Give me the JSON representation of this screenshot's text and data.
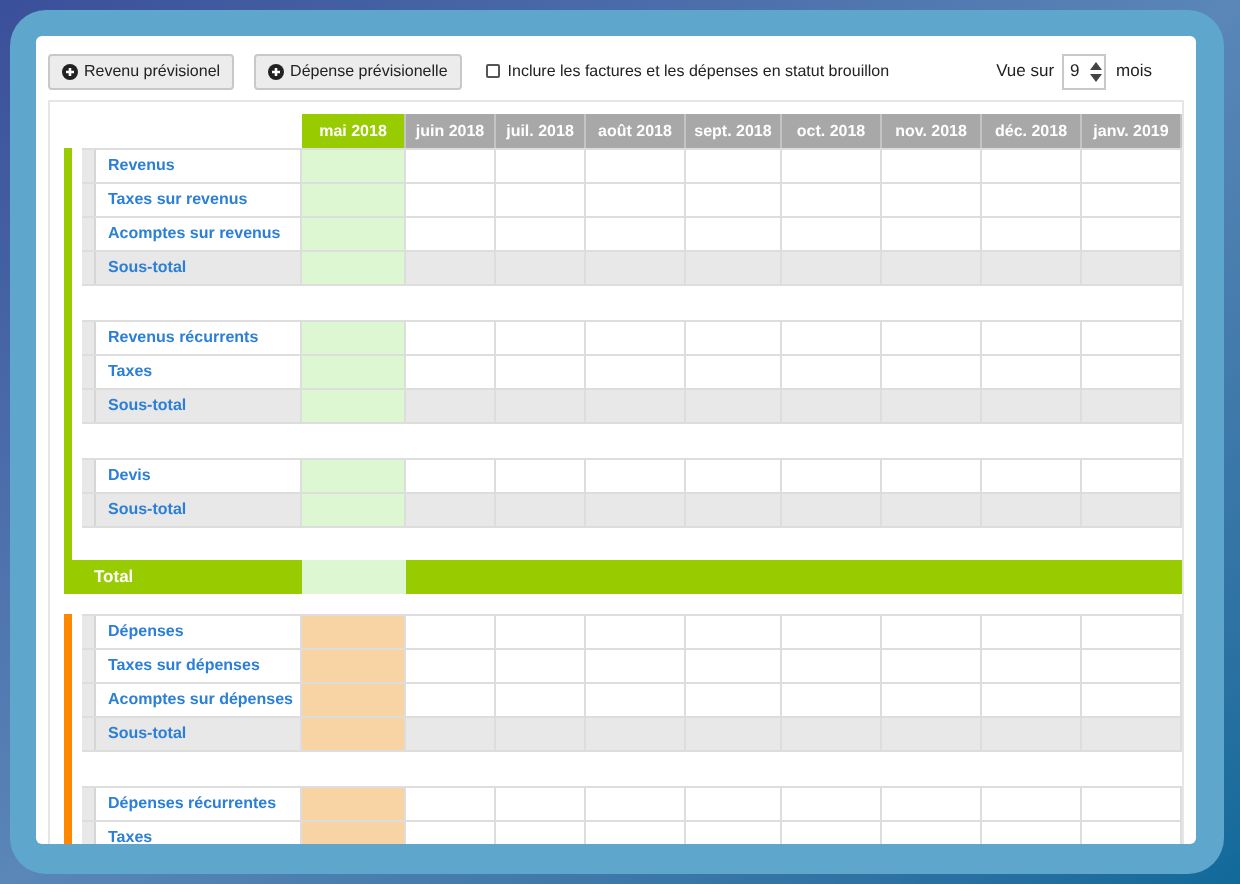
{
  "toolbar": {
    "buttons": [
      {
        "label": "Revenu prévisionel"
      },
      {
        "label": "Dépense prévisionelle"
      }
    ],
    "draft_checkbox": {
      "label": "Inclure les factures et les dépenses en statut brouillon",
      "checked": false
    },
    "view": {
      "prefix": "Vue sur",
      "value": "9",
      "suffix": "mois"
    }
  },
  "columns": [
    {
      "label": "mai 2018",
      "selected": true
    },
    {
      "label": "juin 2018",
      "selected": false
    },
    {
      "label": "juil. 2018",
      "selected": false
    },
    {
      "label": "août 2018",
      "selected": false
    },
    {
      "label": "sept. 2018",
      "selected": false
    },
    {
      "label": "oct. 2018",
      "selected": false
    },
    {
      "label": "nov. 2018",
      "selected": false
    },
    {
      "label": "déc. 2018",
      "selected": false
    },
    {
      "label": "janv. 2019",
      "selected": false
    }
  ],
  "sections": [
    {
      "kind": "revenue",
      "color": "#99cc00",
      "total": "Total",
      "groups": [
        [
          {
            "label": "Revenus",
            "kind": "line"
          },
          {
            "label": "Taxes sur revenus",
            "kind": "line"
          },
          {
            "label": "Acomptes sur revenus",
            "kind": "line"
          },
          {
            "label": "Sous-total",
            "kind": "subtotal"
          }
        ],
        [
          {
            "label": "Revenus récurrents",
            "kind": "line"
          },
          {
            "label": "Taxes",
            "kind": "line"
          },
          {
            "label": "Sous-total",
            "kind": "subtotal"
          }
        ],
        [
          {
            "label": "Devis",
            "kind": "line"
          },
          {
            "label": "Sous-total",
            "kind": "subtotal"
          }
        ]
      ]
    },
    {
      "kind": "expense",
      "color": "#ff8800",
      "groups": [
        [
          {
            "label": "Dépenses",
            "kind": "line"
          },
          {
            "label": "Taxes sur dépenses",
            "kind": "line"
          },
          {
            "label": "Acomptes sur dépenses",
            "kind": "line"
          },
          {
            "label": "Sous-total",
            "kind": "subtotal"
          }
        ],
        [
          {
            "label": "Dépenses récurrentes",
            "kind": "line"
          },
          {
            "label": "Taxes",
            "kind": "line"
          }
        ]
      ]
    }
  ]
}
